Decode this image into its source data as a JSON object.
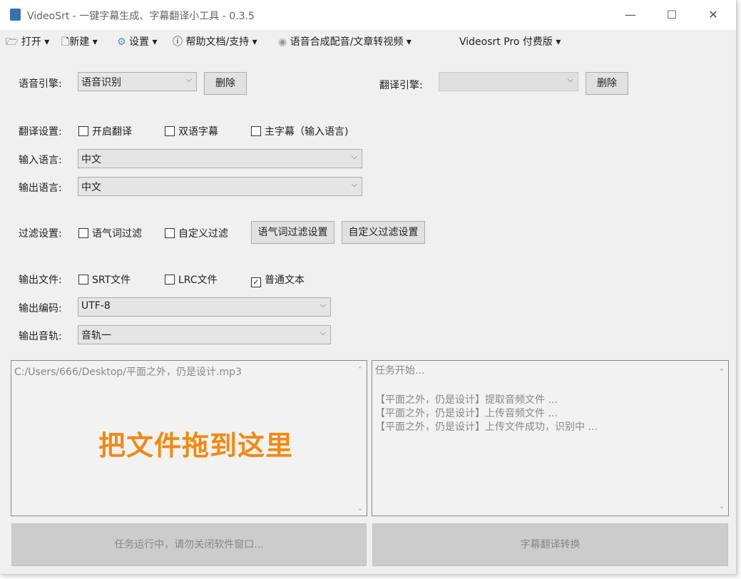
{
  "window": {
    "title": "VideoSrt - 一键字幕生成、字幕翻译小工具 - 0.3.5",
    "minimize": "—",
    "maximize": "☐",
    "close": "✕"
  },
  "menu": [
    {
      "icon": "folder-icon",
      "glyph": "🗁",
      "label": "打开 ▾"
    },
    {
      "icon": "new-file-icon",
      "glyph": "🗋",
      "label": "新建 ▾"
    },
    {
      "icon": "gear-icon",
      "glyph": "⚙",
      "label": "设置 ▾"
    },
    {
      "icon": "info-icon",
      "glyph": "ⓘ",
      "label": "帮助文档/支持 ▾"
    },
    {
      "icon": "audio-icon",
      "glyph": "◉",
      "label": "语音合成配音/文章转视频  ▾"
    },
    {
      "icon": "",
      "glyph": "",
      "label": "Videosrt Pro 付费版  ▾"
    }
  ],
  "engine": {
    "label": "语音引擎:",
    "value": "语音识别",
    "delete": "删除",
    "trans_label": "翻译引擎:",
    "trans_value": "",
    "trans_delete": "删除"
  },
  "translate": {
    "label": "翻译设置:",
    "options": [
      {
        "label": "开启翻译",
        "checked": false
      },
      {
        "label": "双语字幕",
        "checked": false
      },
      {
        "label": "主字幕（输入语言)",
        "checked": false
      }
    ]
  },
  "input_lang": {
    "label": "输入语言:",
    "value": "中文"
  },
  "output_lang": {
    "label": "输出语言:",
    "value": "中文"
  },
  "filter": {
    "label": "过滤设置:",
    "options": [
      {
        "label": "语气词过滤",
        "checked": false
      },
      {
        "label": "自定义过滤",
        "checked": false
      }
    ],
    "btn1": "语气词过滤设置",
    "btn2": "自定义过滤设置"
  },
  "output_file": {
    "label": "输出文件:",
    "options": [
      {
        "label": "SRT文件",
        "checked": false
      },
      {
        "label": "LRC文件",
        "checked": false
      },
      {
        "label": "普通文本",
        "checked": true
      }
    ]
  },
  "encoding": {
    "label": "输出编码:",
    "value": "UTF-8"
  },
  "track": {
    "label": "输出音轨:",
    "value": "音轨一"
  },
  "drop": {
    "path": "C:/Users/666/Desktop/平面之外，仍是设计.mp3",
    "hint": "把文件拖到这里"
  },
  "log": {
    "start": "任务开始...",
    "lines": [
      "【平面之外，仍是设计】提取音频文件 ...",
      "【平面之外，仍是设计】上传音频文件 ...",
      "【平面之外，仍是设计】上传文件成功，识别中 ..."
    ]
  },
  "buttons": {
    "run": "任务运行中，请勿关闭软件窗口...",
    "translate": "字幕翻译转换"
  }
}
